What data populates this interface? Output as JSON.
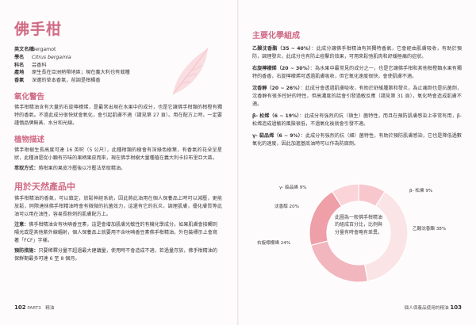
{
  "header": {
    "title": "佛手柑"
  },
  "info": [
    {
      "key": "英文名稱",
      "value": "Bergamot",
      "italic": false
    },
    {
      "key": "學名",
      "value": "Citrus bergamia",
      "italic": true
    },
    {
      "key": "科名",
      "value": "芸香科",
      "italic": false
    },
    {
      "key": "產地",
      "value": "原生長在亞洲熱帶地區；現在義大利也有栽種",
      "italic": false
    },
    {
      "key": "香氣",
      "value": "深邃的草本香氣，前調是柑橘香",
      "italic": false
    }
  ],
  "warning": {
    "title": "氧化警告",
    "text": "佛手柑精油含有大量的右旋檸檬烯，是最常出現在水果中的成分，也是它讓佛手柑類的柑橙有獨特的香氣。不過此成分很快就會氧化，會引起肌膚不適（請見第 27 頁）。用在配方上時，一定要謹慎品牌無蒸、水分和光線。"
  },
  "botany": {
    "title": "植物描述",
    "text": "佛手柑樹生長高度可達 16 英呎（5 公尺），此種柑類的樹會有深綠色樹葉，有香氣的花朵呈星狀，此種油是從小顆有芬味的果柄果皮而來，現在佛手柑樹大量種植在義大利卡拉布里亞大區。",
    "method_label": "萃取方式：",
    "method_text": "將柑果的果皮冷壓後以冷壓法萃取精油。"
  },
  "uses": {
    "title": "用於天然產品中",
    "intro": "佛手柑精油的香氣，可以鎮定，放鬆神經系統，因此將此油用在個人保養品上時可以減壓，更能放鬆，同際達抹佛手柑精油時會有微微的抗菌效力，這還有它的抗炎，調理肌膚，優化膚質等此油可以用在油性，容易長粉刺的肌膚配方上。",
    "note1_label": "注意：",
    "note1_text": "佛手柑精油含有呋喃香豆素，這是會增加肌膚光敏性的有機化學成分。如果肌膚會接觸到陽光或是其他紫外線輻射，個人保養品上就要用不含呋喃香豆素佛手柑精油，外包裝標示上會寫著「FCF」字樣。",
    "note2_label": "預防措施：",
    "note2_text": "只要稀釋分量不超過最大建議量，使用時不會造成不適，若過量存放，佛手柑精油的保鮮期最多可達 6 至 8 個月。"
  },
  "chemistry": {
    "title": "主要化學組成",
    "items": [
      {
        "term": "乙酸沈香酯（35 ~ 40%）",
        "text": "此成分讓佛手柑精油有其獨特香氣，它會經由肌膚吸收，有助於預防，調理發炎，此成分也有防止痘擊的效果，可用來鬆弛肌肉和舒緩極痛的症狀。"
      },
      {
        "term": "右旋檸檬烯（20 ~ 30%）",
        "text": "為水果中最常見的成分之一，也是它讓佛手柑和其他柑橙類水果有獨特的香香，右旋檸檬烯可透過肌膚吸收，但它氧化速度很快，會使肌膚不適。"
      },
      {
        "term": "沈香醇（20 ~ 26%）",
        "text": "此成分會透過肌膚吸收，有助於舒緩腫脹和發炎，為止痛劑也是抗菌劑，沈香醇有很多控好的特性，但高濃度的話會引發過敏反應（請見第 31 頁），氧化時會造成肌膚不適。"
      },
      {
        "term": "β- 松烯（6 ~ 19%）",
        "text": "此成分有強烈的抗（微生）菌特性，而且在預防肌膚感染上非常有用，β- 松烯造成過敏的風險很低，不過氧化後就會引發不適。"
      },
      {
        "term": "γ- 萜品烯（6 ~ 9%）",
        "text": "此成分有強烈的抗（細）菌特性，有助於預防肌膚感染，它也是降低過數氧化的速度，因此加進基底油時可以作為防腐劑。"
      }
    ]
  },
  "chart_data": {
    "type": "pie",
    "categories": [
      "乙酸沈香酯",
      "右旋檸檬烯",
      "沈香醇",
      "γ- 萜品烯",
      "β- 松烯"
    ],
    "values": [
      38,
      24,
      20,
      9,
      9
    ],
    "labels": [
      "乙酸沈香酯 38%",
      "右旋檸檬烯 24%",
      "沈香醇 20%",
      "γ- 萜品烯 9%",
      "β- 松烯 9%"
    ],
    "center_text": "此圖為一般佛手柑精油的組成百分比，比例與分量有時會略有差異。",
    "colors": [
      "#fbe4e6",
      "#f2b6be",
      "#ee9fa8",
      "#fad4d8",
      "#f7c7cd"
    ]
  },
  "footer": {
    "left_num": "102",
    "left_text": "PART3　精油",
    "right_text": "個人保養品使用的精油",
    "right_num": "103"
  }
}
